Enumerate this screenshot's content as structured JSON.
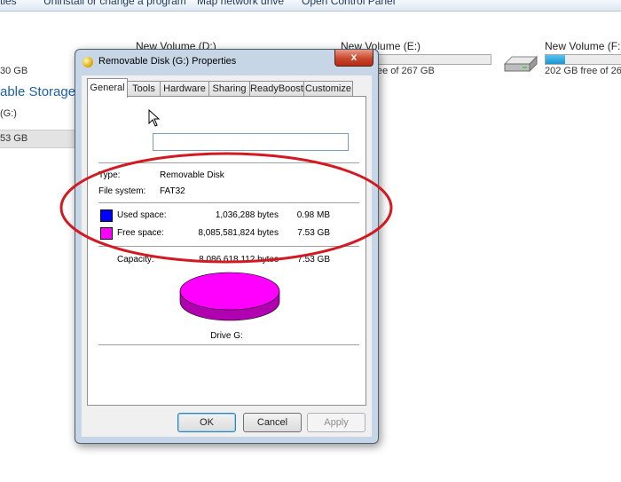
{
  "toolbar": {
    "items": [
      "ties",
      "Uninstall or change a program",
      "Map network drive",
      "Open Control Panel"
    ]
  },
  "explorer": {
    "drives": [
      {
        "name": "New Volume (D:)",
        "free_text": "30 GB",
        "usage": 0.0
      },
      {
        "name": "New Volume (E:)",
        "free_text": "ee of 267 GB",
        "usage": 0.0
      },
      {
        "name": "New Volume (F:)",
        "free_text": "202 GB free of 267 GB",
        "usage": 0.25
      }
    ],
    "section_header": "able Storage (",
    "removable_item_name": "(G:)",
    "removable_item_size": "53 GB"
  },
  "dialog": {
    "title": "Removable Disk (G:) Properties",
    "close_label": "x",
    "tabs": [
      "General",
      "Tools",
      "Hardware",
      "Sharing",
      "ReadyBoost",
      "Customize"
    ],
    "active_tab": "General",
    "name_value": "",
    "type_label": "Type:",
    "type_value": "Removable Disk",
    "fs_label": "File system:",
    "fs_value": "FAT32",
    "used": {
      "label": "Used space:",
      "bytes": "1,036,288 bytes",
      "size": "0.98 MB",
      "color": "#0000ff"
    },
    "free": {
      "label": "Free space:",
      "bytes": "8,085,581,824 bytes",
      "size": "7.53 GB",
      "color": "#ff00ff"
    },
    "capacity": {
      "label": "Capacity:",
      "bytes": "8,086,618,112 bytes",
      "size": "7.53 GB"
    },
    "used_fraction": 0.0001,
    "drive_label": "Drive G:",
    "buttons": {
      "ok": "OK",
      "cancel": "Cancel",
      "apply": "Apply"
    }
  },
  "annotation": {
    "ellipse_color": "#d11a22"
  }
}
